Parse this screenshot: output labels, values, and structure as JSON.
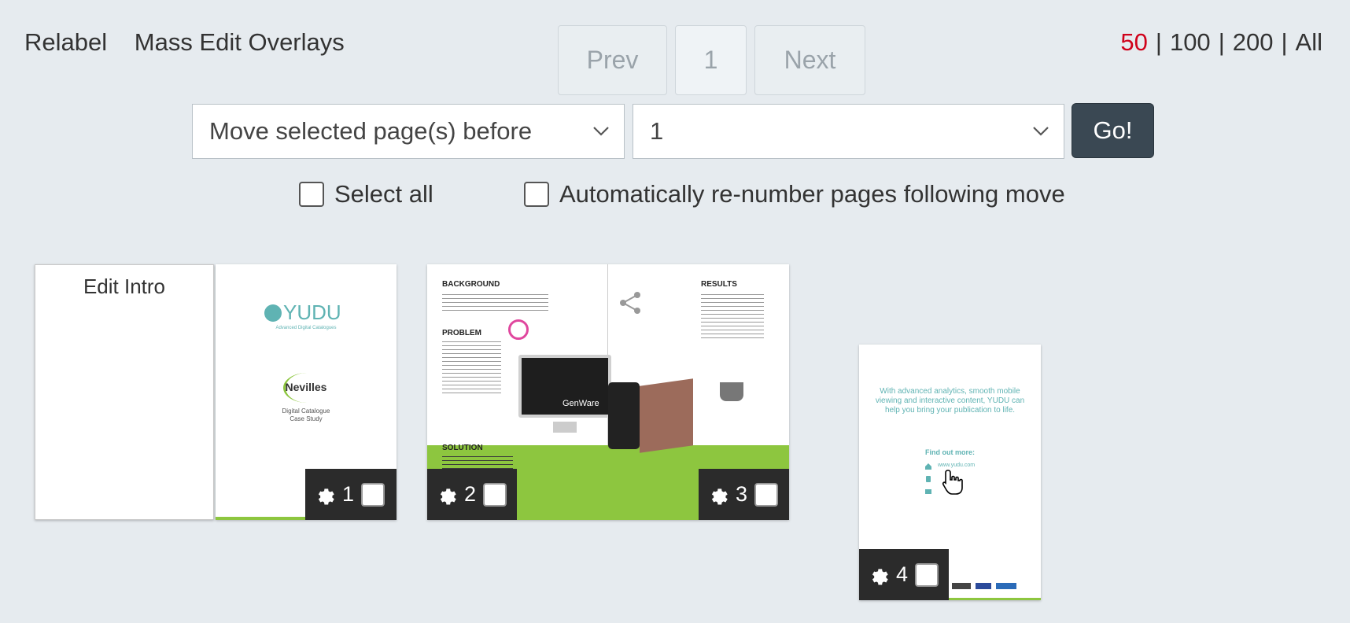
{
  "toolbar": {
    "relabel": "Relabel",
    "mass_edit": "Mass Edit Overlays"
  },
  "pager": {
    "prev": "Prev",
    "current": "1",
    "next": "Next"
  },
  "per_page": {
    "options": [
      "50",
      "100",
      "200",
      "All"
    ],
    "separator": "|",
    "active_color": "#d0021b"
  },
  "move": {
    "action_value": "Move selected page(s) before",
    "target_value": "1",
    "go_label": "Go!"
  },
  "checks": {
    "select_all": "Select all",
    "auto_renumber": "Automatically re-number pages following move"
  },
  "pages": {
    "intro_label": "Edit Intro",
    "items": [
      {
        "number": "1"
      },
      {
        "number": "2"
      },
      {
        "number": "3"
      },
      {
        "number": "4"
      }
    ]
  },
  "cover": {
    "brand": "YUDU",
    "brand_tag": "Advanced Digital Catalogues",
    "client": "Nevilles",
    "subtitle_1": "Digital Catalogue",
    "subtitle_2": "Case Study"
  },
  "spread": {
    "background_heading": "BACKGROUND",
    "problem_heading": "PROBLEM",
    "solution_heading": "SOLUTION",
    "results_heading": "RESULTS",
    "screen_text": "GenWare"
  },
  "back": {
    "tagline": "With advanced analytics, smooth mobile viewing and interactive content, YUDU can help you bring your publication to life.",
    "find_out": "Find out more:",
    "web": "www.yudu.com"
  },
  "colors": {
    "accent_green": "#8dc63f",
    "teal": "#5fb3b3",
    "go_button": "#3a4853"
  }
}
